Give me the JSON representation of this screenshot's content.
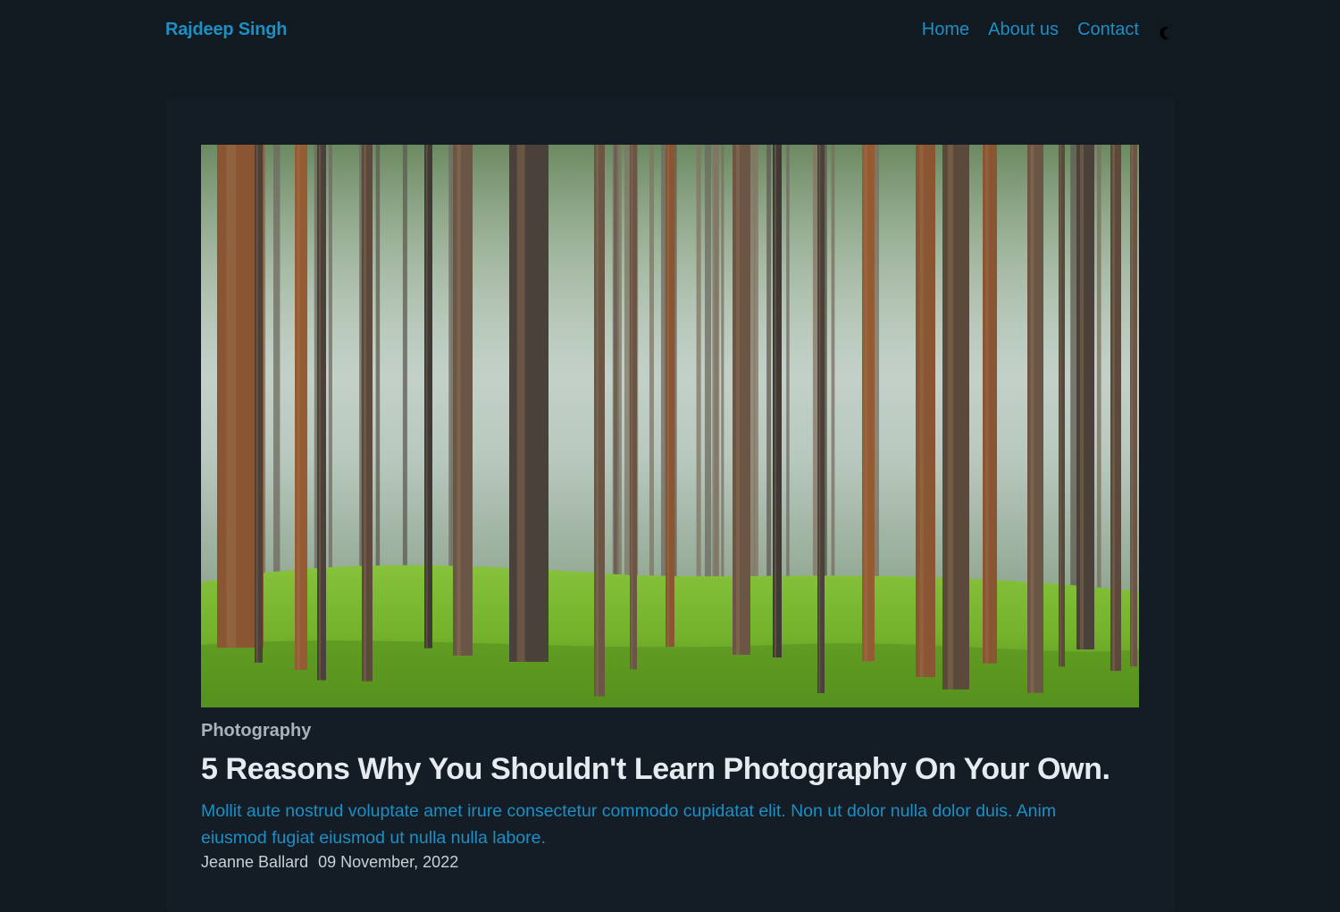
{
  "header": {
    "brand": "Rajdeep Singh",
    "nav": [
      {
        "label": "Home"
      },
      {
        "label": "About us"
      },
      {
        "label": "Contact"
      }
    ],
    "theme_toggle_icon": "moon-icon"
  },
  "post": {
    "image_icon": "forest-photo",
    "category": "Photography",
    "title": "5 Reasons Why You Shouldn't Learn Photography On Your Own.",
    "excerpt": "Mollit aute nostrud voluptate amet irure consectetur commodo cupidatat elit. Non ut dolor nulla dolor duis. Anim eiusmod fugiat eiusmod ut nulla nulla labore.",
    "author": "Jeanne Ballard",
    "date": "09 November, 2022"
  },
  "colors": {
    "page_bg": "#111921",
    "card_bg": "#141d26",
    "accent": "#1c8fc4",
    "title": "#e6ebf0",
    "category": "#a9b2bc"
  }
}
